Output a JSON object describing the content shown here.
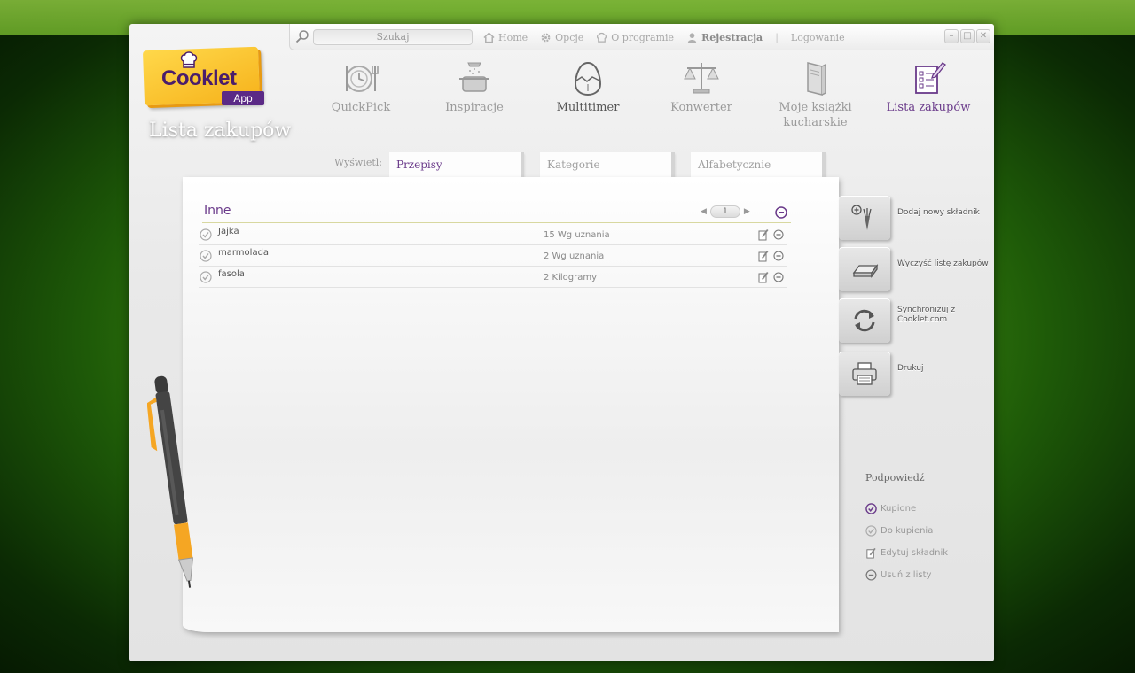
{
  "app": {
    "logo_text": "Cooklet",
    "logo_badge": "App",
    "page_title": "Lista zakupów"
  },
  "topbar": {
    "search_placeholder": "Szukaj",
    "links": {
      "home": "Home",
      "options": "Opcje",
      "about": "O programie",
      "register": "Rejestracja",
      "separator": "|",
      "login": "Logowanie"
    },
    "window_buttons": {
      "minimize": "–",
      "maximize": "□",
      "close": "✕"
    }
  },
  "nav": {
    "items": [
      {
        "label": "QuickPick",
        "icon": "clock-plate-icon"
      },
      {
        "label": "Inspiracje",
        "icon": "pot-icon"
      },
      {
        "label": "Multitimer",
        "icon": "egg-timer-icon"
      },
      {
        "label": "Konwerter",
        "icon": "scales-icon"
      },
      {
        "label": "Moje książki kucharskie",
        "icon": "book-icon"
      },
      {
        "label": "Lista zakupów",
        "icon": "checklist-icon"
      }
    ]
  },
  "filter": {
    "label": "Wyświetl:",
    "tabs": [
      "Przepisy",
      "Kategorie",
      "Alfabetycznie"
    ],
    "active": "Przepisy"
  },
  "list": {
    "group_title": "Inne",
    "page": "1",
    "items": [
      {
        "name": "Jajka",
        "qty": "15 Wg uznania"
      },
      {
        "name": "marmolada",
        "qty": "2 Wg uznania"
      },
      {
        "name": "fasola",
        "qty": "2 Kilogramy"
      }
    ]
  },
  "actions": {
    "add": "Dodaj nowy składnik",
    "clear": "Wyczyść listę zakupów",
    "sync": "Synchronizuj z Cooklet.com",
    "print": "Drukuj"
  },
  "legend": {
    "title": "Podpowiedź",
    "bought": "Kupione",
    "to_buy": "Do kupienia",
    "edit": "Edytuj składnik",
    "remove": "Usuń z listy"
  },
  "colors": {
    "accent": "#6a3a8a",
    "logo_yellow": "#f6b21b",
    "logo_purple": "#5b2a86",
    "background_green": "#3d8a10"
  }
}
